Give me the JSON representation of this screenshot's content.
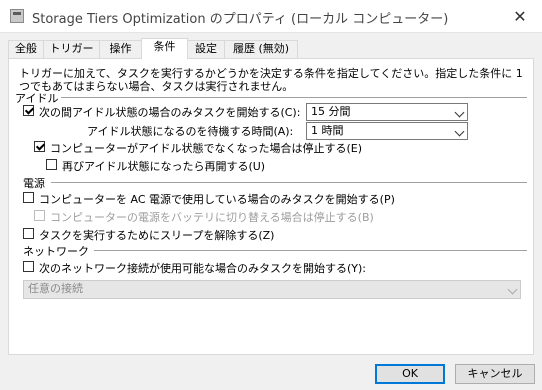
{
  "window": {
    "title": "Storage Tiers Optimization のプロパティ (ローカル コンピューター)"
  },
  "tabs": [
    {
      "label": "全般"
    },
    {
      "label": "トリガー"
    },
    {
      "label": "操作"
    },
    {
      "label": "条件",
      "active": true
    },
    {
      "label": "設定"
    },
    {
      "label": "履歴 (無効)"
    }
  ],
  "intro": "トリガーに加えて、タスクを実行するかどうかを決定する条件を指定してください。指定した条件に 1 つでもあてはまらない場合、タスクは実行されません。",
  "idle": {
    "header": "アイドル",
    "start_only_if_idle": {
      "label": "次の間アイドル状態の場合のみタスクを開始する(C):",
      "checked": true
    },
    "idle_duration": {
      "value": "15 分間"
    },
    "wait_label": "アイドル状態になるのを待機する時間(A):",
    "wait_duration": {
      "value": "1 時間"
    },
    "stop_if_not_idle": {
      "label": "コンピューターがアイドル状態でなくなった場合は停止する(E)",
      "checked": true
    },
    "restart_if_idle": {
      "label": "再びアイドル状態になったら再開する(U)",
      "checked": false
    }
  },
  "power": {
    "header": "電源",
    "ac_only": {
      "label": "コンピューターを AC 電源で使用している場合のみタスクを開始する(P)",
      "checked": false
    },
    "stop_on_battery": {
      "label": "コンピューターの電源をバッテリに切り替える場合は停止する(B)",
      "checked": false,
      "disabled": true
    },
    "wake": {
      "label": "タスクを実行するためにスリープを解除する(Z)",
      "checked": false
    }
  },
  "network": {
    "header": "ネットワーク",
    "only_if_network": {
      "label": "次のネットワーク接続が使用可能な場合のみタスクを開始する(Y):",
      "checked": false
    },
    "connection": {
      "value": "任意の接続",
      "disabled": true
    }
  },
  "buttons": {
    "ok": "OK",
    "cancel": "キャンセル"
  },
  "icons": {
    "window": "task-scheduler-icon",
    "close": "close-icon",
    "dropdown": "chevron-down-icon"
  }
}
